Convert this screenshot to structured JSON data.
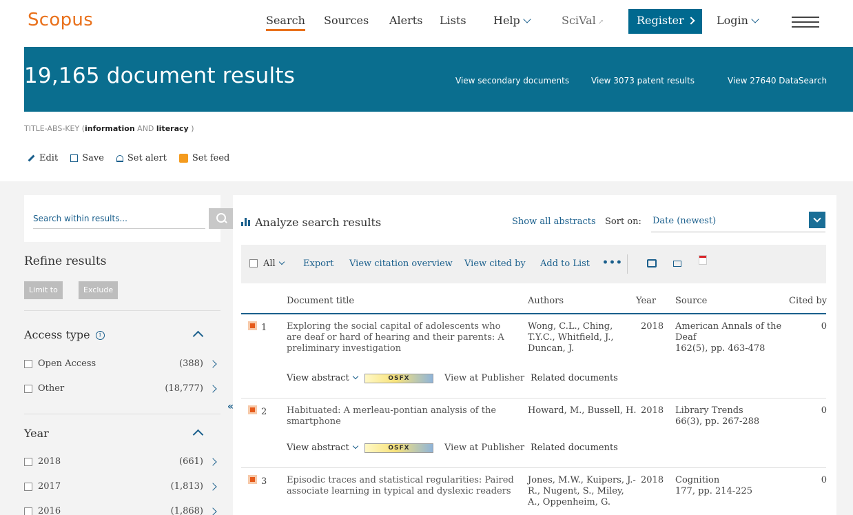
{
  "nav": {
    "logo": "Scopus",
    "items": [
      "Search",
      "Sources",
      "Alerts",
      "Lists",
      "Help",
      "SciVal"
    ],
    "register": "Register",
    "login": "Login"
  },
  "banner": {
    "title": "19,165 document results",
    "links": [
      "View secondary documents",
      "View 3073 patent results",
      "View 27640 DataSearch"
    ]
  },
  "query": {
    "prefix": "TITLE-ABS-KEY (",
    "term1": "information",
    "op": " AND ",
    "term2": "literacy",
    "suffix": " )"
  },
  "actions": [
    "Edit",
    "Save",
    "Set alert",
    "Set feed"
  ],
  "sidebar": {
    "search_placeholder": "Search within results...",
    "refine_title": "Refine results",
    "limit_to": "Limit to",
    "exclude": "Exclude",
    "access_title": "Access type",
    "access": [
      {
        "label": "Open Access",
        "count": "(388)"
      },
      {
        "label": "Other",
        "count": "(18,777)"
      }
    ],
    "year_title": "Year",
    "years": [
      {
        "label": "2018",
        "count": "(661)"
      },
      {
        "label": "2017",
        "count": "(1,813)"
      },
      {
        "label": "2016",
        "count": "(1,868)"
      }
    ]
  },
  "main": {
    "analyze": "Analyze search results",
    "show_all": "Show all abstracts",
    "sort_on": "Sort on:",
    "sort_value": "Date (newest)",
    "toolbar": {
      "all": "All",
      "export": "Export",
      "view_citation": "View citation overview",
      "view_cited": "View cited by",
      "add_list": "Add to List",
      "more": "•••"
    },
    "columns": {
      "title": "Document title",
      "authors": "Authors",
      "year": "Year",
      "source": "Source",
      "cited": "Cited by"
    },
    "rows": [
      {
        "num": "1",
        "title": "Exploring the social capital of adolescents who are deaf or hard of hearing and their parents: A preliminary investigation",
        "authors": "Wong, C.L., Ching, T.Y.C., Whitfield, J., Duncan, J.",
        "year": "2018",
        "source": "American Annals of the Deaf\n162(5), pp. 463-478",
        "cited": "0"
      },
      {
        "num": "2",
        "title": "Habituated: A merleau-pontian analysis of the smartphone",
        "authors": "Howard, M., Bussell, H.",
        "year": "2018",
        "source": "Library Trends\n66(3), pp. 267-288",
        "cited": "0"
      },
      {
        "num": "3",
        "title": "Episodic traces and statistical regularities: Paired associate learning in typical and dyslexic readers",
        "authors": "Jones, M.W., Kuipers, J.-R., Nugent, S., Miley, A., Oppenheim, G.",
        "year": "2018",
        "source": "Cognition\n177, pp. 214-225",
        "cited": "0"
      }
    ],
    "row_links": {
      "view_abstract": "View abstract",
      "osfx": "OSFX",
      "view_publisher": "View at Publisher",
      "related": "Related documents"
    }
  }
}
